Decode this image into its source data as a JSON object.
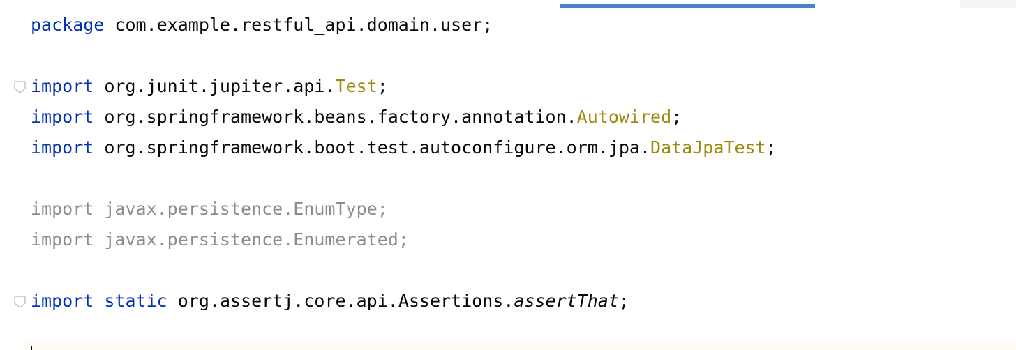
{
  "editor": {
    "lines": [
      {
        "kw1": "package",
        "body": " com.example.restful_api.domain.user;"
      },
      {
        "blank": ""
      },
      {
        "kw1": "import",
        "body": " org.junit.jupiter.api.",
        "ann": "Test",
        "end": ";"
      },
      {
        "kw1": "import",
        "body": " org.springframework.beans.factory.annotation.",
        "ann": "Autowired",
        "end": ";"
      },
      {
        "kw1": "import",
        "body": " org.springframework.boot.test.autoconfigure.orm.jpa.",
        "ann": "DataJpaTest",
        "end": ";"
      },
      {
        "blank": ""
      },
      {
        "unused": "import javax.persistence.EnumType;"
      },
      {
        "unused": "import javax.persistence.Enumerated;"
      },
      {
        "blank": ""
      },
      {
        "kw1": "import",
        "kw2": "static",
        "body": " org.assertj.core.api.Assertions.",
        "ital": "assertThat",
        "end": ";"
      }
    ]
  },
  "colors": {
    "keyword": "#0033b3",
    "annotation": "#9e880d",
    "unused_import": "#8c8c8c",
    "scroll_indicator": "#4a84c4"
  },
  "icons": {
    "fold_marker": "fold-marker-icon"
  }
}
